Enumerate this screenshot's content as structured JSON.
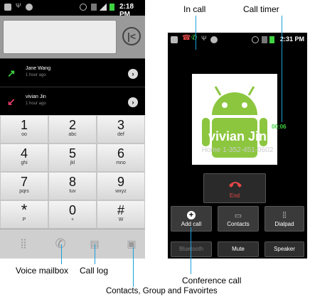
{
  "left_phone": {
    "status_time": "2:18 PM",
    "call_log": [
      {
        "name": "Jane Wang",
        "time": "1 hour ago",
        "type": "outgoing"
      },
      {
        "name": "vivian Jin",
        "time": "1 hour ago",
        "type": "missed"
      }
    ],
    "keys": [
      {
        "digit": "1",
        "letters": ""
      },
      {
        "digit": "2",
        "letters": "abc"
      },
      {
        "digit": "3",
        "letters": "def"
      },
      {
        "digit": "4",
        "letters": "ghi"
      },
      {
        "digit": "5",
        "letters": "jkl"
      },
      {
        "digit": "6",
        "letters": "mno"
      },
      {
        "digit": "7",
        "letters": "pqrs"
      },
      {
        "digit": "8",
        "letters": "tuv"
      },
      {
        "digit": "9",
        "letters": "wxyz"
      },
      {
        "digit": "*",
        "letters": "P"
      },
      {
        "digit": "0",
        "letters": "+"
      },
      {
        "digit": "#",
        "letters": "W"
      }
    ]
  },
  "right_phone": {
    "status_time": "2:31 PM",
    "call_timer": "00:06",
    "caller_name": "vivian Jin",
    "caller_phone": "Home 1-352-451-0602",
    "end_label": "End",
    "buttons": {
      "add_call": "Add call",
      "contacts": "Contacts",
      "dialpad": "Dialpad",
      "bluetooth": "Bluetooth",
      "mute": "Mute",
      "speaker": "Speaker"
    }
  },
  "annotations": {
    "in_call": "In call",
    "call_timer": "Call timer",
    "voice_mailbox": "Voice mailbox",
    "call_log": "Call log",
    "conference_call": "Conference call",
    "contacts_groups": "Contacts, Group and Favoirtes"
  },
  "colors": {
    "accent_blue": "#1aa0dc",
    "missed_red": "#e83a6a",
    "outgoing_green": "#3fd43f",
    "end_red": "#e84848",
    "android_green": "#8cc63f"
  },
  "icons": {
    "back": "backspace-icon",
    "voicemail": "voicemail-icon",
    "call_log": "call-log-icon",
    "contacts": "contacts-icon",
    "end_call": "phone-hangup-icon",
    "add_call": "plus-icon"
  }
}
